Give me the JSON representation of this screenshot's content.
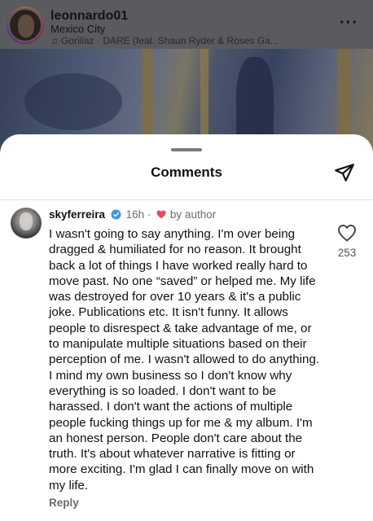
{
  "post": {
    "username": "leonnardo01",
    "location": "Mexico City",
    "song": "Gorillaz · DARE (feat. Shaun Ryder & Roses Ga...",
    "more_icon": "more-horizontal-icon"
  },
  "sheet": {
    "title": "Comments",
    "share_icon": "send-paper-plane-icon"
  },
  "comment": {
    "username": "skyferreira",
    "verified": true,
    "time": "16h",
    "separator": "·",
    "by_author": "by author",
    "text": "I wasn't going to say anything. I'm over being dragged & humiliated for no reason. It brought back a lot of things I have worked really hard to move past. No one “saved” or helped me. My life was destroyed for over 10 years & it's a public joke. Publications etc. It isn't funny. It allows people to disrespect & take advantage of me, or to manipulate multiple situations based on their perception of me. I wasn't allowed to do anything. I mind my own business so I don't know why everything is so loaded. I don't want to be harassed. I don't want the actions of multiple people fucking things up for me & my album. I'm an honest person. People don't care about the truth. It's about whatever narrative is fitting or more exciting. I'm glad I can finally move on with my life.",
    "reply_label": "Reply",
    "like_count": "253"
  },
  "colors": {
    "verified_blue": "#3897f0",
    "author_heart": "#ed4956",
    "secondary_text": "#6b6b6b"
  }
}
